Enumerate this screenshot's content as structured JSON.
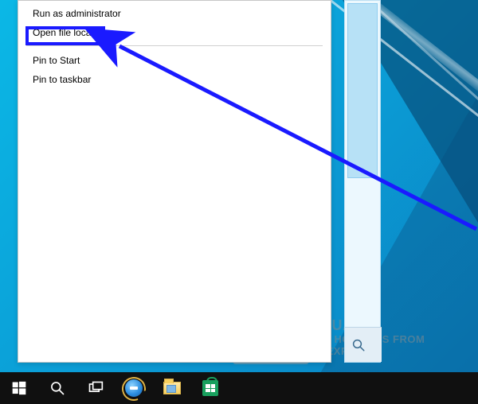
{
  "context_menu": {
    "items": [
      {
        "label": "Run as administrator"
      },
      {
        "label": "Open file location"
      },
      {
        "label": "Pin to Start"
      },
      {
        "label": "Pin to taskbar"
      }
    ]
  },
  "taskbar": {
    "icons": {
      "start": "start-icon",
      "search": "search-icon",
      "taskview": "taskview-icon",
      "ie": "internet-explorer-icon",
      "file_explorer": "file-explorer-icon",
      "store": "windows-store-icon"
    }
  },
  "watermark": {
    "line1": "APPUALS",
    "line2": "TECH HOW-TO'S FROM",
    "line3": "THE EXPERTS!"
  },
  "annotation": {
    "highlighted_item_index": 1
  }
}
